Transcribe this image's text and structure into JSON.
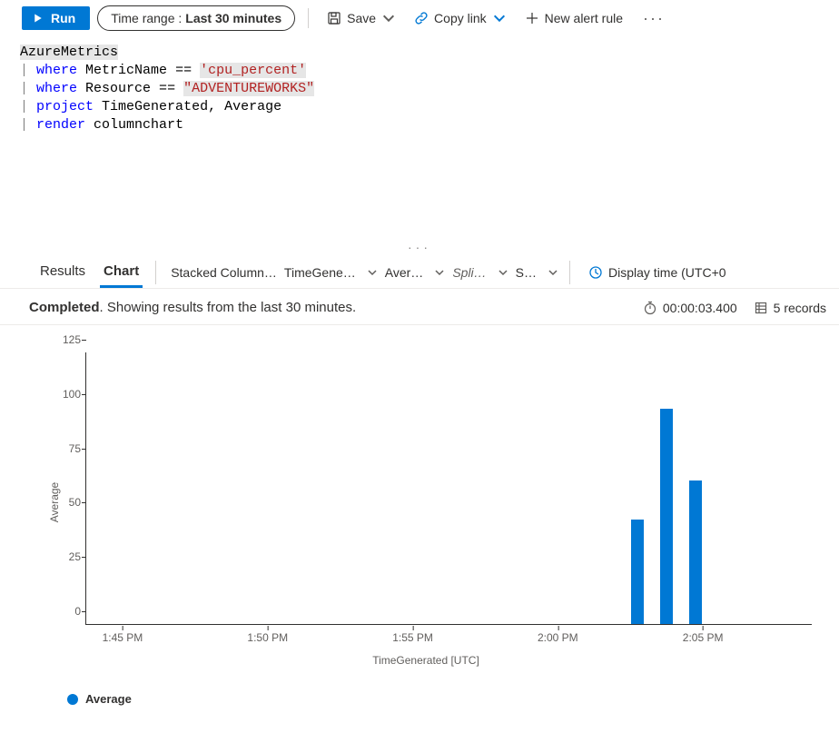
{
  "toolbar": {
    "run_label": "Run",
    "time_range_label": "Time range :",
    "time_range_value": "Last 30 minutes",
    "save_label": "Save",
    "copy_link_label": "Copy link",
    "new_alert_label": "New alert rule"
  },
  "query": {
    "table": "AzureMetrics",
    "line1_kw": "where",
    "line1_rest": " MetricName == ",
    "line1_str": "'cpu_percent'",
    "line2_kw": "where",
    "line2_rest": " Resource == ",
    "line2_str": "\"ADVENTUREWORKS\"",
    "line3_kw": "project",
    "line3_rest": " TimeGenerated, Average",
    "line4_kw": "render",
    "line4_rest": " columnchart"
  },
  "tabs": {
    "results": "Results",
    "chart": "Chart",
    "chart_type": "Stacked Column…",
    "x_field": "TimeGene…",
    "y_field": "Aver…",
    "split_field": "Spli…",
    "agg_field": "S…",
    "display_time": "Display time (UTC+0"
  },
  "status": {
    "completed": "Completed",
    "rest": ". Showing results from the last 30 minutes.",
    "duration": "00:00:03.400",
    "records": "5 records"
  },
  "chart_data": {
    "type": "bar",
    "title": "",
    "ylabel": "Average",
    "xlabel": "TimeGenerated [UTC]",
    "ylim": [
      0,
      125
    ],
    "y_ticks": [
      0,
      25,
      50,
      75,
      100,
      125
    ],
    "x_ticks": [
      "1:45 PM",
      "1:50 PM",
      "1:55 PM",
      "2:00 PM",
      "2:05 PM"
    ],
    "x_tick_positions_pct": [
      5,
      25,
      45,
      65,
      85
    ],
    "series": [
      {
        "name": "Average",
        "points": [
          {
            "x_pct": 76,
            "value": 48
          },
          {
            "x_pct": 80,
            "value": 99
          },
          {
            "x_pct": 84,
            "value": 66
          }
        ]
      }
    ],
    "legend": [
      "Average"
    ]
  }
}
